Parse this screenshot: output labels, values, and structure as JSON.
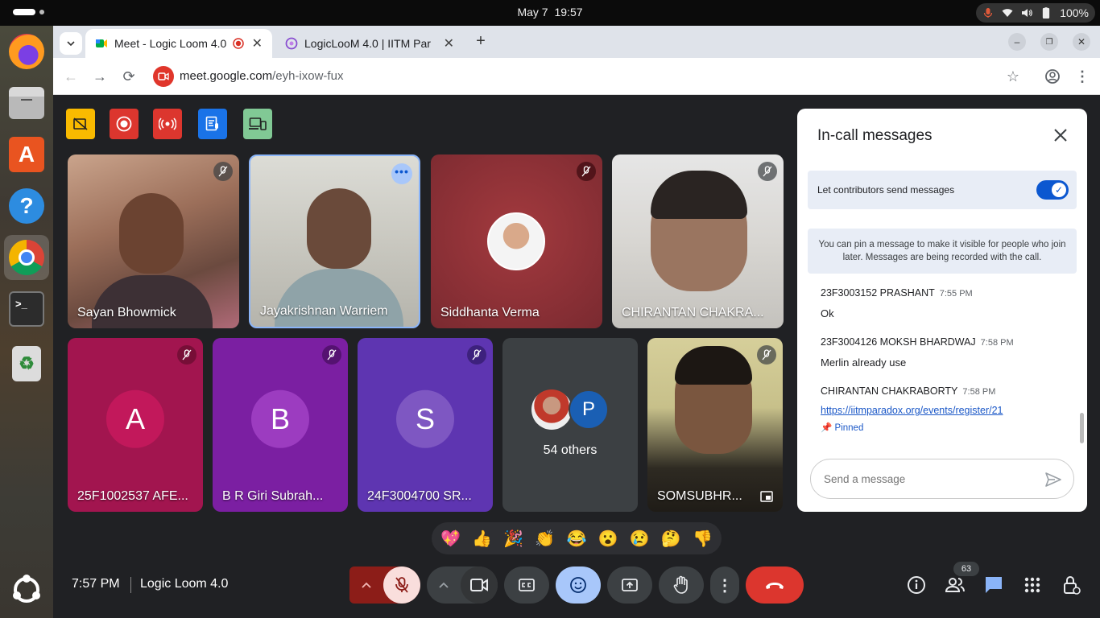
{
  "system": {
    "date": "May 7",
    "time": "19:57",
    "battery": "100%"
  },
  "dock": {
    "apps": [
      {
        "name": "Firefox",
        "icon": "firefox-icon"
      },
      {
        "name": "Files",
        "icon": "files-icon"
      },
      {
        "name": "App Center",
        "icon": "app-center-icon"
      },
      {
        "name": "Help",
        "icon": "help-icon"
      },
      {
        "name": "Google Chrome",
        "icon": "chrome-icon",
        "active": true
      },
      {
        "name": "Terminal",
        "icon": "terminal-icon"
      },
      {
        "name": "Trash",
        "icon": "trash-icon"
      }
    ]
  },
  "browser": {
    "tabs": [
      {
        "title": "Meet - Logic Loom 4.0",
        "active": true,
        "recording": true
      },
      {
        "title": "LogicLooM 4.0 | IITM Par",
        "active": false
      }
    ],
    "url_domain": "meet.google.com",
    "url_path": "/eyh-ixow-fux"
  },
  "meet": {
    "participants": [
      {
        "name": "Sayan Bhowmick",
        "muted": true
      },
      {
        "name": "Jayakrishnan Warriem",
        "muted": false,
        "active_speaker": true
      },
      {
        "name": "Siddhanta Verma",
        "muted": true
      },
      {
        "name": "CHIRANTAN CHAKRA...",
        "muted": true
      },
      {
        "name": "25F1002537 AFE...",
        "initial": "A",
        "muted": true
      },
      {
        "name": "B R Giri Subrah...",
        "initial": "B",
        "muted": true
      },
      {
        "name": "24F3004700 SR...",
        "initial": "S",
        "muted": true
      },
      {
        "name": "SOMSUBHR...",
        "muted": true
      }
    ],
    "others": {
      "label": "54 others",
      "initial": "P"
    },
    "reactions": [
      "💖",
      "👍",
      "🎉",
      "👏",
      "😂",
      "😮",
      "😢",
      "🤔",
      "👎"
    ],
    "meeting_time": "7:57 PM",
    "meeting_name": "Logic Loom 4.0",
    "people_count": "63"
  },
  "chat": {
    "title": "In-call messages",
    "toggle_label": "Let contributors send messages",
    "toggle_on": true,
    "info": "You can pin a message to make it visible for people who join later. Messages are being recorded with the call.",
    "messages": [
      {
        "sender": "23F3003152 PRASHANT",
        "time": "7:55 PM",
        "text": "Ok"
      },
      {
        "sender": "23F3004126 MOKSH BHARDWAJ",
        "time": "7:58 PM",
        "text": "Merlin already use"
      },
      {
        "sender": "CHIRANTAN CHAKRABORTY",
        "time": "7:58 PM",
        "link": "https://iitmparadox.org/events/register/21",
        "pinned": "Pinned"
      }
    ],
    "input_placeholder": "Send a message"
  },
  "colors": {
    "meet_bg": "#202124",
    "accent_blue": "#0b57d0",
    "end_call_red": "#dc362e",
    "reaction_active": "#a8c7fa"
  }
}
